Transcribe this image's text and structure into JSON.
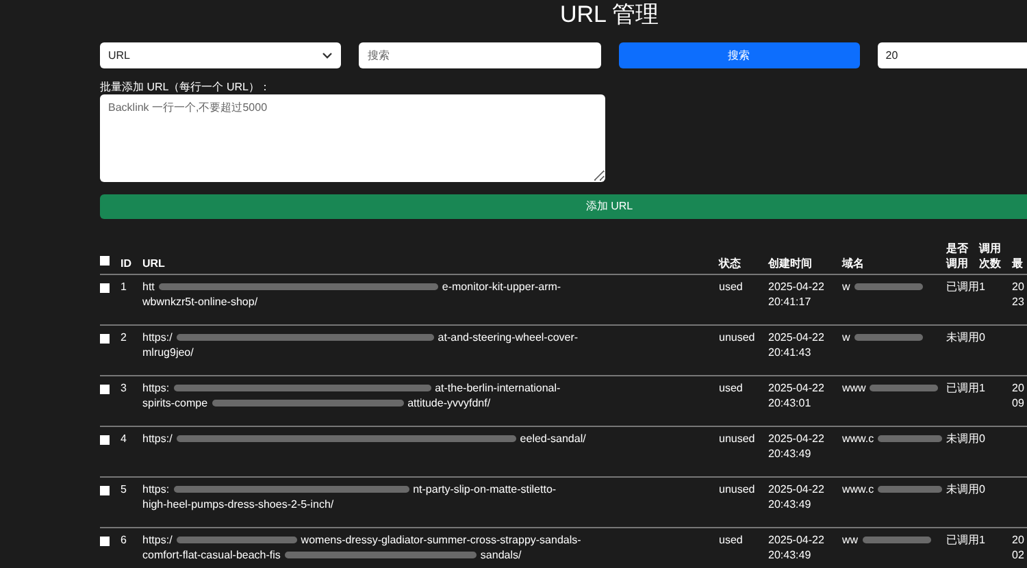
{
  "title": "URL 管理",
  "filters": {
    "field": "URL",
    "search_placeholder": "搜索",
    "search_button": "搜索",
    "page_size": "20"
  },
  "bulk_add": {
    "label": "批量添加 URL（每行一个 URL）：",
    "placeholder": "Backlink 一行一个,不要超过5000",
    "button": "添加 URL"
  },
  "table": {
    "select_all_checked": false,
    "columns": [
      "ID",
      "URL",
      "状态",
      "创建时间",
      "域名",
      "是否调用",
      "调用次数",
      "最"
    ],
    "rows": [
      {
        "checked": false,
        "id": "1",
        "url": [
          [
            "htt",
            "e-monitor-kit-upper-arm-"
          ],
          [
            "wbwnkzr5t-online-shop/"
          ]
        ],
        "status": "used",
        "created": [
          "2025-04-22",
          "20:41:17"
        ],
        "domain": [
          "w"
        ],
        "called": "已调用",
        "count": "1",
        "last": [
          "20",
          "23"
        ]
      },
      {
        "checked": false,
        "id": "2",
        "url": [
          [
            "https:/",
            "at-and-steering-wheel-cover-"
          ],
          [
            "mlrug9jeo/"
          ]
        ],
        "status": "unused",
        "created": [
          "2025-04-22",
          "20:41:43"
        ],
        "domain": [
          "w"
        ],
        "called": "未调用",
        "count": "0",
        "last": []
      },
      {
        "checked": false,
        "id": "3",
        "url": [
          [
            "https:",
            "at-the-berlin-international-"
          ],
          [
            "spirits-compe",
            "attitude-yvvyfdnf/"
          ]
        ],
        "status": "used",
        "created": [
          "2025-04-22",
          "20:43:01"
        ],
        "domain": [
          "www"
        ],
        "called": "已调用",
        "count": "1",
        "last": [
          "20",
          "09"
        ]
      },
      {
        "checked": false,
        "id": "4",
        "url": [
          [
            "https:/",
            "eeled-sandal/"
          ]
        ],
        "status": "unused",
        "created": [
          "2025-04-22",
          "20:43:49"
        ],
        "domain": [
          "www.c"
        ],
        "called": "未调用",
        "count": "0",
        "last": []
      },
      {
        "checked": false,
        "id": "5",
        "url": [
          [
            "https:",
            "nt-party-slip-on-matte-stiletto-"
          ],
          [
            "high-heel-pumps-dress-shoes-2-5-inch/"
          ]
        ],
        "status": "unused",
        "created": [
          "2025-04-22",
          "20:43:49"
        ],
        "domain": [
          "www.c"
        ],
        "called": "未调用",
        "count": "0",
        "last": []
      },
      {
        "checked": false,
        "id": "6",
        "url": [
          [
            "https:/",
            "womens-dressy-gladiator-summer-cross-strappy-sandals-"
          ],
          [
            "comfort-flat-casual-beach-fis",
            "sandals/"
          ]
        ],
        "status": "used",
        "created": [
          "2025-04-22",
          "20:43:49"
        ],
        "domain": [
          "ww"
        ],
        "called": "已调用",
        "count": "1",
        "last": [
          "20",
          "02"
        ]
      }
    ]
  }
}
